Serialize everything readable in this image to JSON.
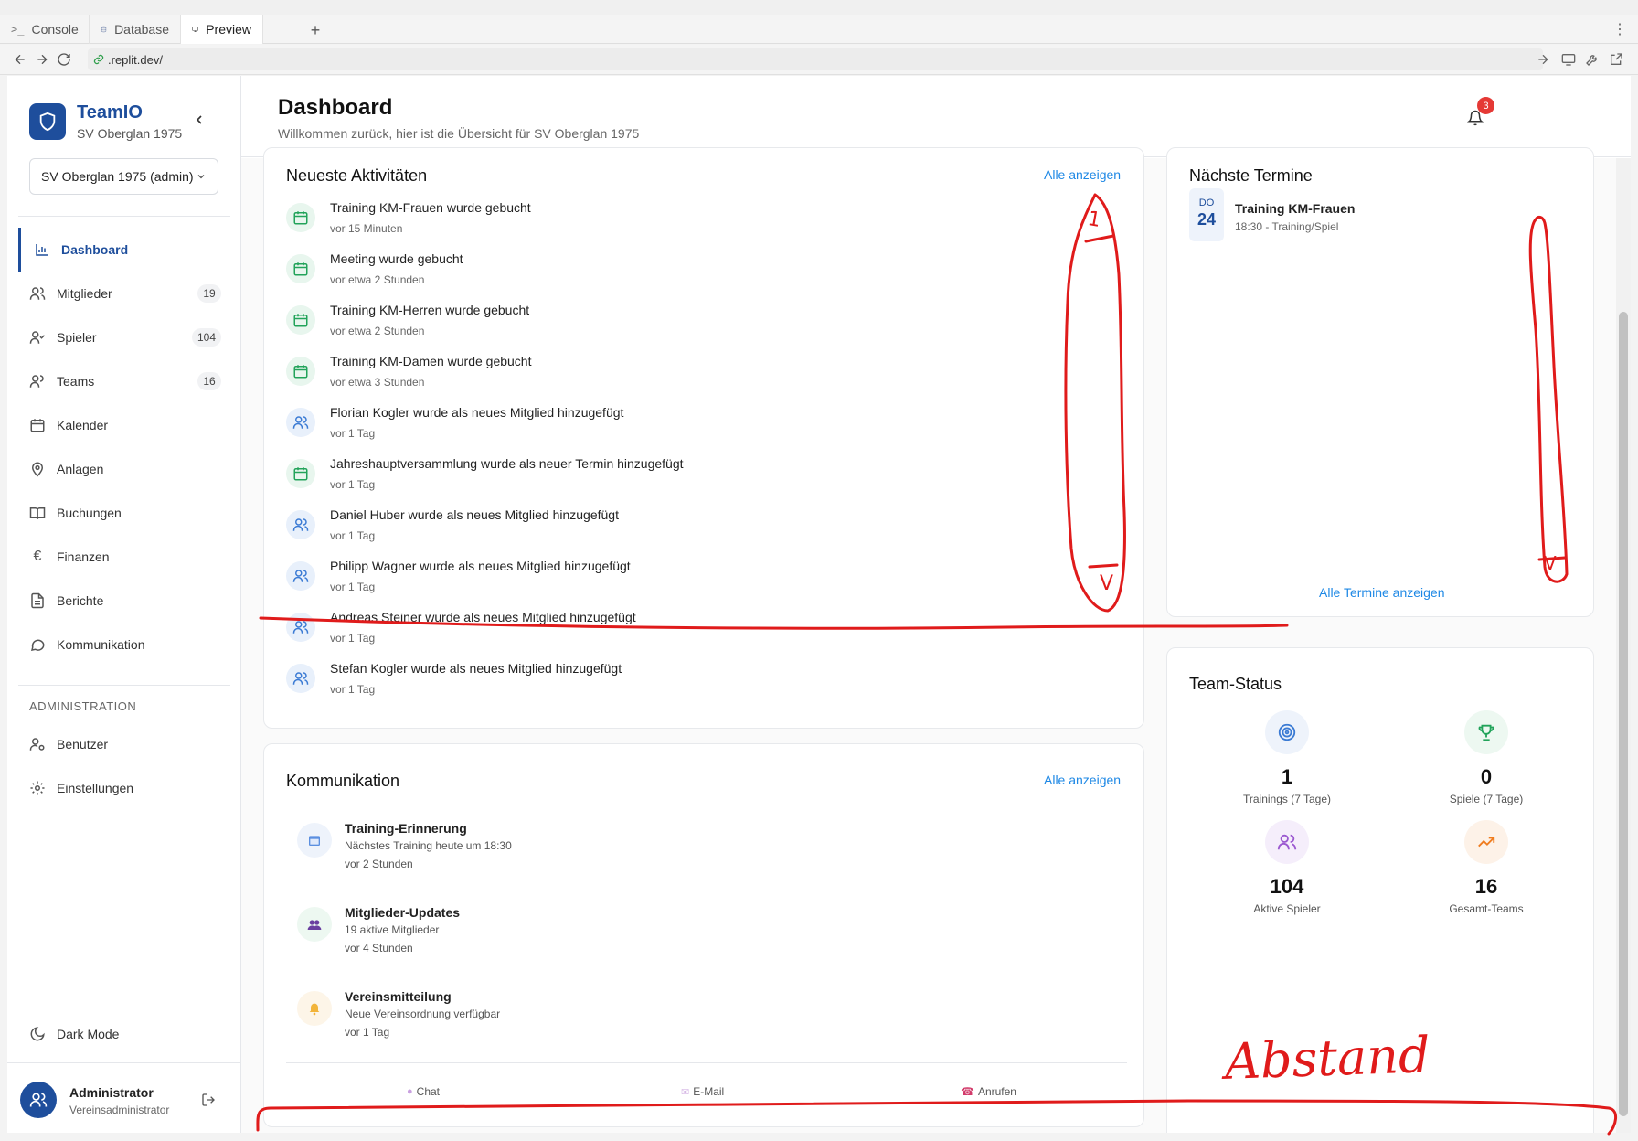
{
  "browser": {
    "tabs": [
      {
        "label": "Console",
        "icon": "terminal-icon"
      },
      {
        "label": "Database",
        "icon": "database-icon"
      },
      {
        "label": "Preview",
        "icon": "monitor-icon"
      }
    ],
    "add_tab": "+",
    "url": ".replit.dev/"
  },
  "sidebar": {
    "brand_name": "TeamIO",
    "brand_sub": "SV Oberglan 1975",
    "club_select": "SV Oberglan 1975 (admin)",
    "items": [
      {
        "label": "Dashboard",
        "badge": ""
      },
      {
        "label": "Mitglieder",
        "badge": "19"
      },
      {
        "label": "Spieler",
        "badge": "104"
      },
      {
        "label": "Teams",
        "badge": "16"
      },
      {
        "label": "Kalender",
        "badge": ""
      },
      {
        "label": "Anlagen",
        "badge": ""
      },
      {
        "label": "Buchungen",
        "badge": ""
      },
      {
        "label": "Finanzen",
        "badge": ""
      },
      {
        "label": "Berichte",
        "badge": ""
      },
      {
        "label": "Kommunikation",
        "badge": ""
      }
    ],
    "admin_section": "ADMINISTRATION",
    "admin_items": [
      {
        "label": "Benutzer"
      },
      {
        "label": "Einstellungen"
      }
    ],
    "dark_mode": "Dark Mode",
    "user_name": "Administrator",
    "user_role": "Vereinsadministrator"
  },
  "header": {
    "title": "Dashboard",
    "subtitle": "Willkommen zurück, hier ist die Übersicht für SV Oberglan 1975",
    "notifications": "3"
  },
  "activities": {
    "title": "Neueste Aktivitäten",
    "link": "Alle anzeigen",
    "items": [
      {
        "text": "Training KM-Frauen wurde gebucht",
        "time": "vor 15 Minuten",
        "type": "calendar"
      },
      {
        "text": "Meeting wurde gebucht",
        "time": "vor etwa 2 Stunden",
        "type": "calendar"
      },
      {
        "text": "Training KM-Herren wurde gebucht",
        "time": "vor etwa 2 Stunden",
        "type": "calendar"
      },
      {
        "text": "Training KM-Damen wurde gebucht",
        "time": "vor etwa 3 Stunden",
        "type": "calendar"
      },
      {
        "text": "Florian Kogler wurde als neues Mitglied hinzugefügt",
        "time": "vor 1 Tag",
        "type": "users"
      },
      {
        "text": "Jahreshauptversammlung wurde als neuer Termin hinzugefügt",
        "time": "vor 1 Tag",
        "type": "calendar"
      },
      {
        "text": "Daniel Huber wurde als neues Mitglied hinzugefügt",
        "time": "vor 1 Tag",
        "type": "users"
      },
      {
        "text": "Philipp Wagner wurde als neues Mitglied hinzugefügt",
        "time": "vor 1 Tag",
        "type": "users"
      },
      {
        "text": "Andreas Steiner wurde als neues Mitglied hinzugefügt",
        "time": "vor 1 Tag",
        "type": "users"
      },
      {
        "text": "Stefan Kogler wurde als neues Mitglied hinzugefügt",
        "time": "vor 1 Tag",
        "type": "users"
      }
    ]
  },
  "communication": {
    "title": "Kommunikation",
    "link": "Alle anzeigen",
    "items": [
      {
        "title": "Training-Erinnerung",
        "desc": "Nächstes Training heute um 18:30",
        "time": "vor 2 Stunden",
        "icon": "calendar-icon"
      },
      {
        "title": "Mitglieder-Updates",
        "desc": "19 aktive Mitglieder",
        "time": "vor 4 Stunden",
        "icon": "people-icon"
      },
      {
        "title": "Vereinsmitteilung",
        "desc": "Neue Vereinsordnung verfügbar",
        "time": "vor 1 Tag",
        "icon": "bell-icon"
      }
    ],
    "actions": [
      "Chat",
      "E-Mail",
      "Anrufen"
    ]
  },
  "events": {
    "title": "Nächste Termine",
    "day": "DO",
    "date": "24",
    "event_title": "Training KM-Frauen",
    "event_sub": "18:30 - Training/Spiel",
    "link": "Alle Termine anzeigen"
  },
  "team_status": {
    "title": "Team-Status",
    "stats": [
      {
        "value": "1",
        "label": "Trainings (7 Tage)",
        "icon": "target-icon",
        "color": "#3b7bd4"
      },
      {
        "value": "0",
        "label": "Spiele (7 Tage)",
        "icon": "trophy-icon",
        "color": "#22a35a"
      },
      {
        "value": "104",
        "label": "Aktive Spieler",
        "icon": "users-icon",
        "color": "#9b59d0"
      },
      {
        "value": "16",
        "label": "Gesamt-Teams",
        "icon": "trending-up-icon",
        "color": "#f07c1e"
      }
    ]
  },
  "annotation": {
    "text": "Abstand",
    "marks": [
      "1",
      "V"
    ],
    "color": "#e01b1b"
  }
}
